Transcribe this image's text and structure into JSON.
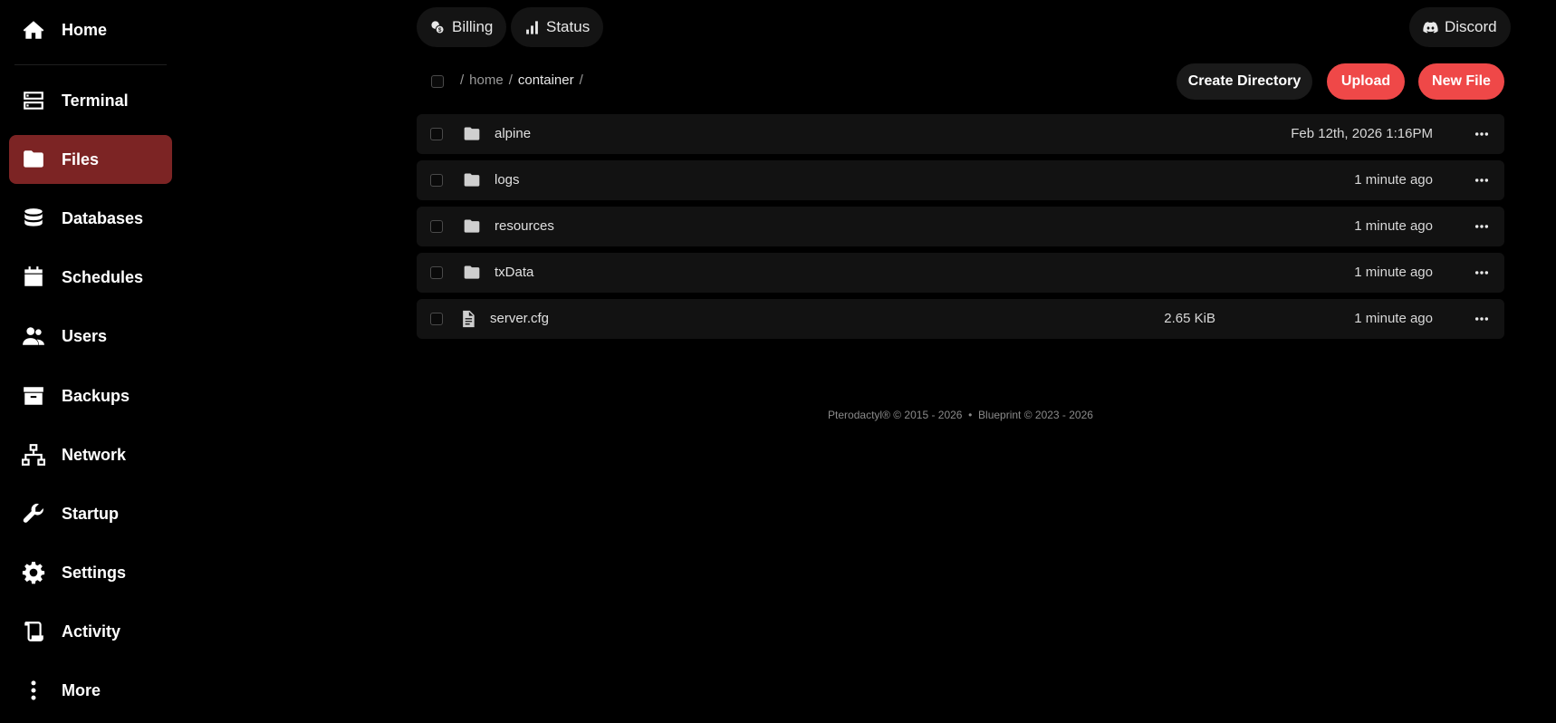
{
  "sidebar": {
    "items": [
      {
        "label": "Home",
        "icon": "home-icon"
      },
      {
        "label": "Terminal",
        "icon": "terminal-icon"
      },
      {
        "label": "Files",
        "icon": "folder-icon",
        "active": true
      },
      {
        "label": "Databases",
        "icon": "database-icon"
      },
      {
        "label": "Schedules",
        "icon": "calendar-icon"
      },
      {
        "label": "Users",
        "icon": "users-icon"
      },
      {
        "label": "Backups",
        "icon": "archive-icon"
      },
      {
        "label": "Network",
        "icon": "network-icon"
      },
      {
        "label": "Startup",
        "icon": "wrench-icon"
      },
      {
        "label": "Settings",
        "icon": "gear-icon"
      },
      {
        "label": "Activity",
        "icon": "scroll-icon"
      },
      {
        "label": "More",
        "icon": "more-vertical-icon"
      }
    ]
  },
  "topbar": {
    "billing_label": "Billing",
    "status_label": "Status",
    "discord_label": "Discord"
  },
  "breadcrumb": {
    "sep": "/",
    "home": "home",
    "container": "container"
  },
  "actions": {
    "create_directory": "Create Directory",
    "upload": "Upload",
    "new_file": "New File"
  },
  "files": [
    {
      "name": "alpine",
      "type": "folder",
      "size": "",
      "modified": "Feb 12th, 2026 1:16PM"
    },
    {
      "name": "logs",
      "type": "folder",
      "size": "",
      "modified": "1 minute ago"
    },
    {
      "name": "resources",
      "type": "folder",
      "size": "",
      "modified": "1 minute ago"
    },
    {
      "name": "txData",
      "type": "folder",
      "size": "",
      "modified": "1 minute ago"
    },
    {
      "name": "server.cfg",
      "type": "file",
      "size": "2.65 KiB",
      "modified": "1 minute ago"
    }
  ],
  "footer": {
    "text": "Pterodactyl® © 2015 - 2026  •  Blueprint © 2023 - 2026"
  },
  "colors": {
    "accent": "#ef4848",
    "active_nav": "#7c2424",
    "background": "#000000",
    "row_background": "#121212"
  }
}
